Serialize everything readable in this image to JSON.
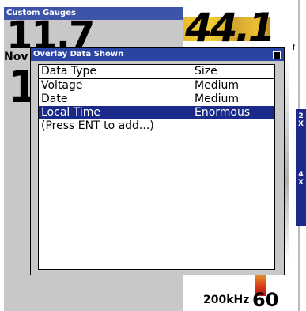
{
  "gauges": {
    "title": "Custom Gauges",
    "big_value": "11.7",
    "date_fragment": "Nov",
    "big_digit": "1"
  },
  "sonar": {
    "depth": "44.1",
    "depth_unit": "ft",
    "frequency": "200kHz",
    "bottom_value": "60",
    "zoom_tabs": [
      "2\nX",
      "4\nX"
    ]
  },
  "dialog": {
    "title": "Overlay Data Shown",
    "columns": [
      "Data Type",
      "Size"
    ],
    "rows": [
      {
        "type": "Voltage",
        "size": "Medium",
        "selected": false
      },
      {
        "type": "Date",
        "size": "Medium",
        "selected": false
      },
      {
        "type": "Local Time",
        "size": "Enormous",
        "selected": true
      }
    ],
    "add_hint": "(Press ENT to add...)"
  },
  "colors": {
    "titlebar": "#2a44a4",
    "selection": "#1a2a8a",
    "panel_gray": "#c8c8c8"
  }
}
